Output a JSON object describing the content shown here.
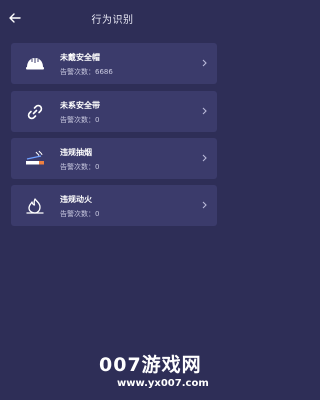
{
  "header": {
    "title": "行为识别",
    "back_icon": "arrow-left-icon"
  },
  "cards": [
    {
      "label": "未戴安全帽",
      "count_label": "告警次数：6686",
      "icon": "helmet-icon"
    },
    {
      "label": "未系安全带",
      "count_label": "告警次数：0",
      "icon": "link-icon"
    },
    {
      "label": "违规抽烟",
      "count_label": "告警次数：0",
      "icon": "cigarette-icon"
    },
    {
      "label": "违规动火",
      "count_label": "告警次数：0",
      "icon": "flame-icon"
    }
  ],
  "watermark": {
    "text": "007游戏网",
    "url": "www.yx007.com"
  },
  "colors": {
    "background": "#2e2e57",
    "card": "#3b3b6b"
  }
}
